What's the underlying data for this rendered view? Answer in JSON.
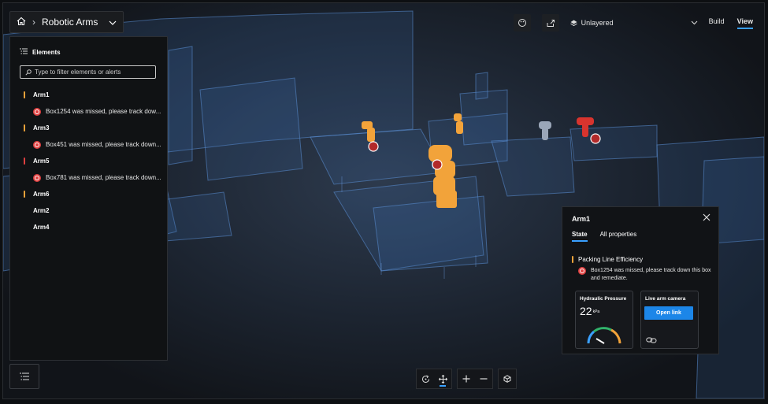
{
  "breadcrumb": {
    "title": "Robotic Arms"
  },
  "topbar": {
    "layer_label": "Unlayered",
    "modes": [
      {
        "label": "Build"
      },
      {
        "label": "View"
      }
    ]
  },
  "elements_panel": {
    "title": "Elements",
    "filter_placeholder": "Type to filter elements or alerts",
    "items": [
      {
        "label": "Arm1",
        "status_color": "#f2a33a",
        "alert": "Box1254 was missed, please track dow..."
      },
      {
        "label": "Arm3",
        "status_color": "#f2a33a",
        "alert": "Box451 was missed, please track down..."
      },
      {
        "label": "Arm5",
        "status_color": "#e04040",
        "alert": "Box781 was missed, please track down..."
      },
      {
        "label": "Arm6",
        "status_color": "#f2a33a"
      },
      {
        "label": "Arm2"
      },
      {
        "label": "Arm4"
      }
    ]
  },
  "arm_card": {
    "title": "Arm1",
    "tabs": [
      {
        "label": "State"
      },
      {
        "label": "All properties"
      }
    ],
    "kpi": "Packing Line Efficiency",
    "alert": "Box1254 was missed, please track down this box and remediate.",
    "hydraulic": {
      "title": "Hydraulic Pressure",
      "value": "22",
      "unit": "kPa"
    },
    "camera": {
      "title": "Live arm camera",
      "button": "Open link"
    }
  },
  "colors": {
    "accent": "#3aa0ff",
    "warning": "#f2a33a",
    "error": "#e04040",
    "button": "#1c86e8"
  }
}
